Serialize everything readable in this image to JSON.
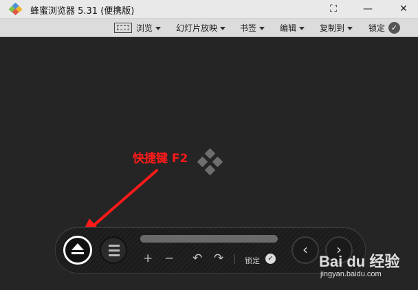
{
  "window": {
    "title": "蜂蜜浏览器 5.31 (便携版)"
  },
  "window_controls": {
    "fullscreen": "⛶",
    "minimize": "—",
    "close": "✕"
  },
  "toolbar": {
    "view": "浏览",
    "slideshow": "幻灯片放映",
    "bookmarks": "书签",
    "edit": "编辑",
    "copy_to": "复制到",
    "lock": "锁定",
    "check": "✓"
  },
  "annotation": {
    "text": "快捷键 F2",
    "color": "#ff1a1a"
  },
  "control_bar": {
    "zoom_in": "+",
    "zoom_out": "−",
    "rotate_left": "↶",
    "rotate_right": "↷",
    "lock": "锁定",
    "check": "✓",
    "prev": "‹",
    "next": "›"
  },
  "watermark": {
    "brand": "Bai du 经验",
    "url": "jingyan.baidu.com"
  }
}
